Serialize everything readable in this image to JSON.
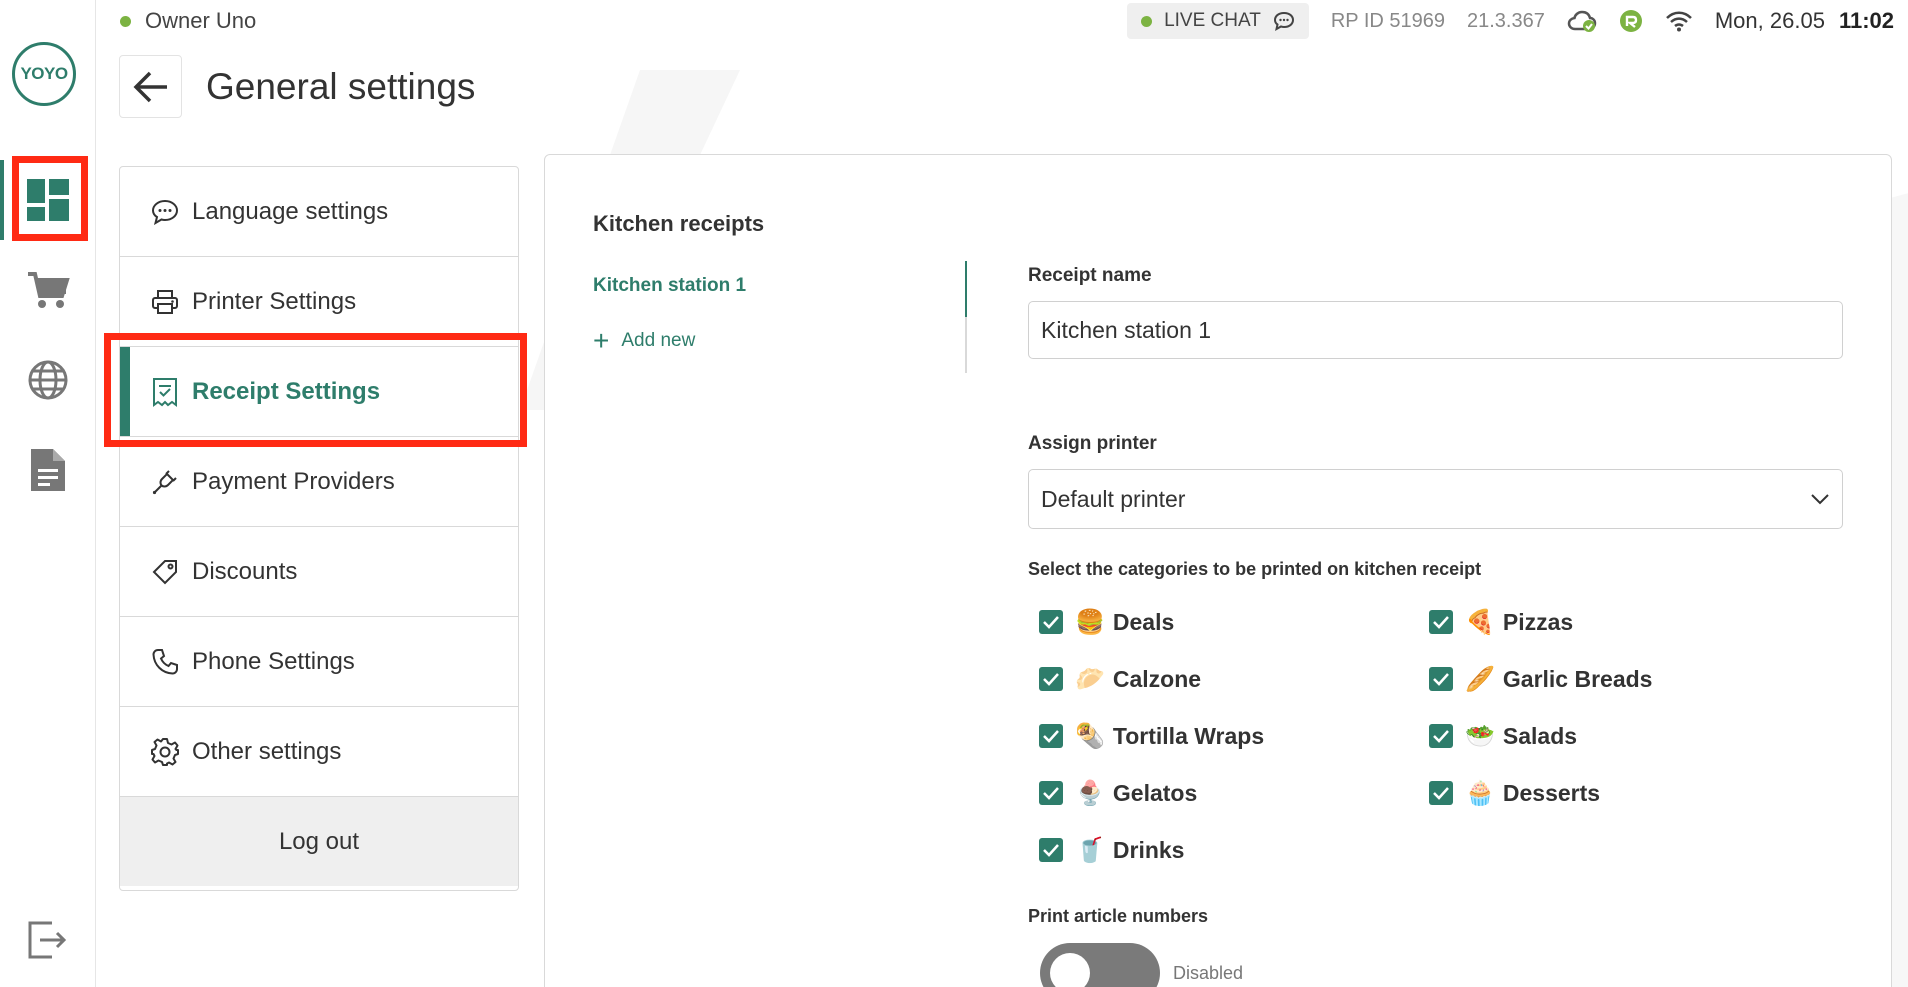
{
  "brand": {
    "logo_text": "YOYO",
    "accent": "#2e7d6b",
    "highlight": "#ff2a14"
  },
  "status": {
    "user": "Owner Uno",
    "live_chat": "LIVE CHAT",
    "rp_id": "RP ID 51969",
    "version": "21.3.367",
    "date": "Mon, 26.05",
    "time": "11:02"
  },
  "rail": {
    "items": [
      {
        "icon": "dashboard-icon",
        "active": true
      },
      {
        "icon": "cart-icon",
        "active": false
      },
      {
        "icon": "globe-icon",
        "active": false
      },
      {
        "icon": "document-icon",
        "active": false
      }
    ],
    "bottom_icon": "exit-icon"
  },
  "header": {
    "title": "General settings"
  },
  "menu": {
    "items": [
      {
        "label": "Language settings",
        "icon": "chat-bubble-icon"
      },
      {
        "label": "Printer Settings",
        "icon": "printer-icon"
      },
      {
        "label": "Receipt Settings",
        "icon": "receipt-icon",
        "active": true
      },
      {
        "label": "Payment Providers",
        "icon": "plug-icon"
      },
      {
        "label": "Discounts",
        "icon": "tag-icon"
      },
      {
        "label": "Phone Settings",
        "icon": "phone-icon"
      },
      {
        "label": "Other settings",
        "icon": "gear-icon"
      }
    ],
    "logout": "Log out"
  },
  "receipts": {
    "section_title": "Kitchen receipts",
    "stations": [
      "Kitchen station 1"
    ],
    "add_new": "Add new",
    "receipt_name_label": "Receipt name",
    "receipt_name_value": "Kitchen station 1",
    "assign_printer_label": "Assign printer",
    "assign_printer_value": "Default printer",
    "categories_label": "Select the categories to be printed on kitchen receipt",
    "categories": [
      {
        "emoji": "🍔",
        "name": "Deals",
        "checked": true
      },
      {
        "emoji": "🍕",
        "name": "Pizzas",
        "checked": true
      },
      {
        "emoji": "🥟",
        "name": "Calzone",
        "checked": true
      },
      {
        "emoji": "🥖",
        "name": "Garlic Breads",
        "checked": true
      },
      {
        "emoji": "🌯",
        "name": "Tortilla Wraps",
        "checked": true
      },
      {
        "emoji": "🥗",
        "name": "Salads",
        "checked": true
      },
      {
        "emoji": "🍨",
        "name": "Gelatos",
        "checked": true
      },
      {
        "emoji": "🧁",
        "name": "Desserts",
        "checked": true
      },
      {
        "emoji": "🥤",
        "name": "Drinks",
        "checked": true
      }
    ],
    "print_article_label": "Print article numbers",
    "print_article_state": "Disabled"
  }
}
